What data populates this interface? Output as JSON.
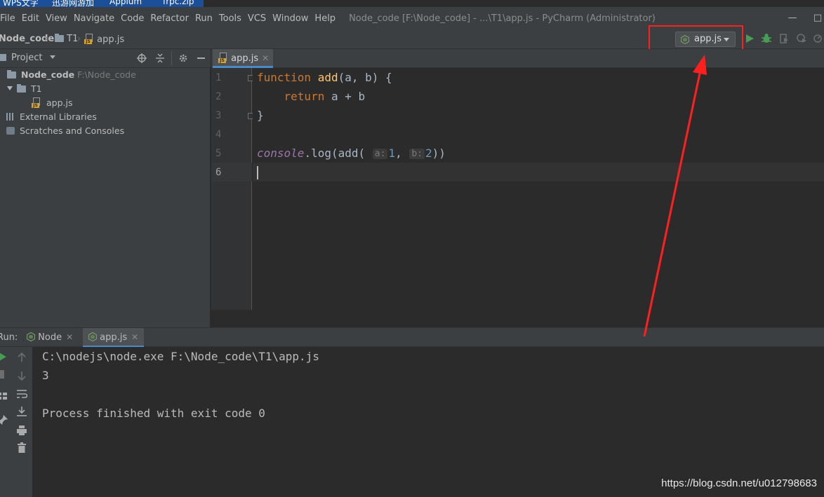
{
  "taskbar": [
    "WPS文字",
    "迅游网游加",
    "Appium",
    "frpc.zip"
  ],
  "menu": [
    "File",
    "Edit",
    "View",
    "Navigate",
    "Code",
    "Refactor",
    "Run",
    "Tools",
    "VCS",
    "Window",
    "Help"
  ],
  "window_title": "Node_code [F:\\Node_code] - ...\\T1\\app.js - PyCharm (Administrator)",
  "breadcrumb": {
    "project": "Node_code",
    "folder": "T1",
    "file": "app.js"
  },
  "run_config": {
    "label": "app.js"
  },
  "project_panel": {
    "header": "Project",
    "tree": {
      "root_name": "Node_code",
      "root_path": "F:\\Node_code",
      "folder": "T1",
      "file": "app.js",
      "external_libraries": "External Libraries",
      "scratches": "Scratches and Consoles"
    }
  },
  "editor": {
    "tab": "app.js",
    "line_numbers": [
      "1",
      "2",
      "3",
      "4",
      "5",
      "6"
    ],
    "code": {
      "l1_kw": "function ",
      "l1_fn": "add",
      "l1_rest": "(a, b) {",
      "l2_indent": "    ",
      "l2_kw": "return",
      "l2_rest": " a + b",
      "l3": "}",
      "l5_obj": "console",
      "l5_mid": ".log(add( ",
      "l5_hint_a": "a:",
      "l5_arg1": "1",
      "l5_comma": ", ",
      "l5_hint_b": "b:",
      "l5_arg2": "2",
      "l5_end": "))"
    }
  },
  "run_panel": {
    "label": "Run:",
    "tabs": [
      "Node",
      "app.js"
    ],
    "output": [
      "C:\\nodejs\\node.exe F:\\Node_code\\T1\\app.js",
      "3",
      "",
      "Process finished with exit code 0"
    ]
  },
  "watermark": "https://blog.csdn.net/u012798683",
  "colors": {
    "annotation_red": "#ff1f1f",
    "accent": "#4a88c7"
  }
}
